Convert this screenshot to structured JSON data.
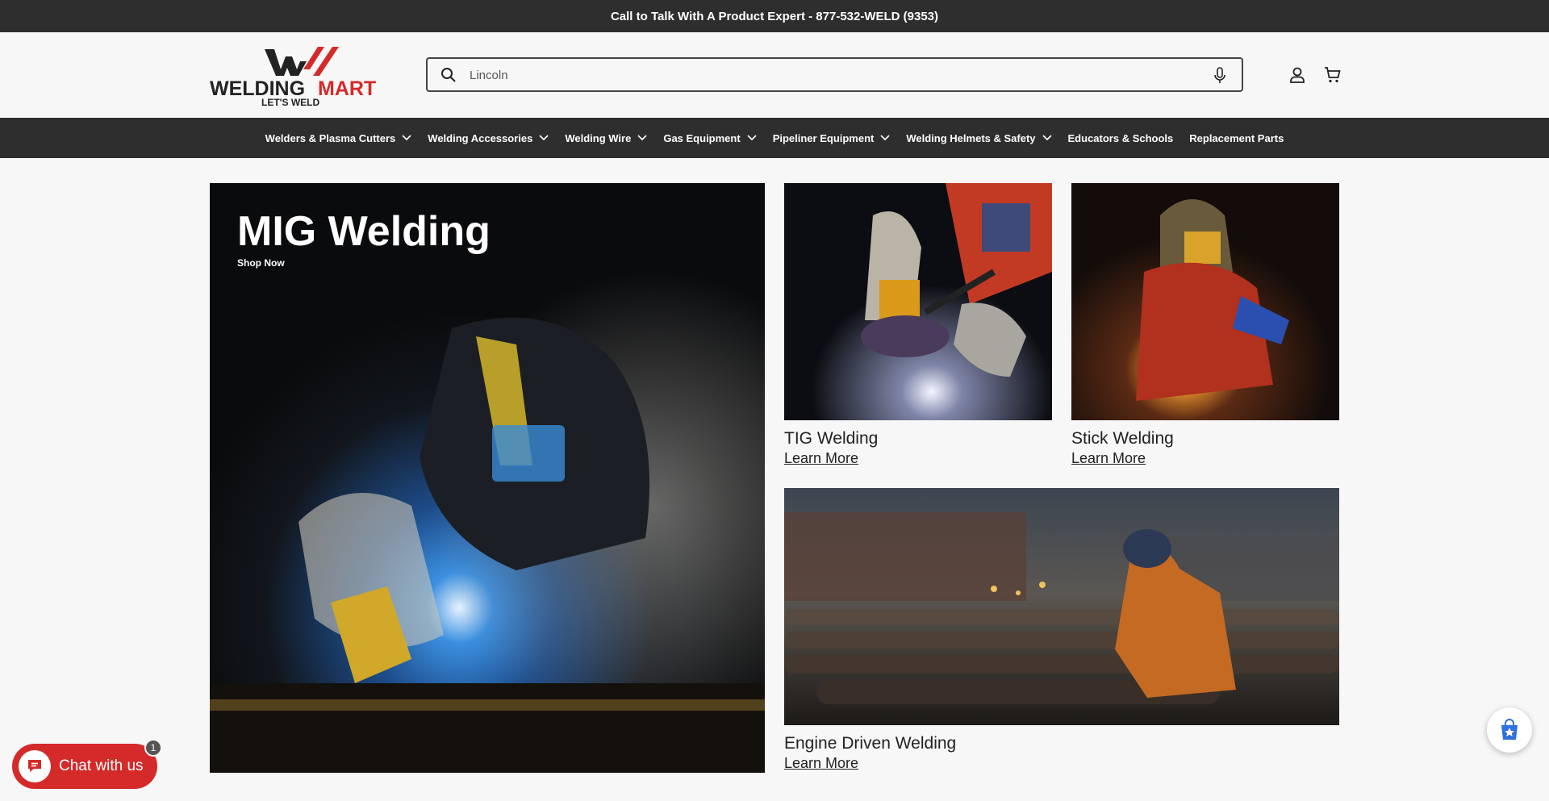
{
  "announcement": "Call to Talk With A Product Expert - 877-532-WELD (9353)",
  "logo": {
    "brand_main": "WELDING",
    "brand_accent": "MART",
    "tagline": "LET'S WELD",
    "accent_color": "#d42a2a"
  },
  "search": {
    "value": "",
    "placeholder": "Lincoln",
    "icon": "search-icon",
    "voice_icon": "microphone-icon"
  },
  "header_icons": [
    "account-icon",
    "cart-icon"
  ],
  "nav": {
    "items": [
      {
        "label": "Welders & Plasma Cutters",
        "has_dropdown": true
      },
      {
        "label": "Welding Accessories",
        "has_dropdown": true
      },
      {
        "label": "Welding Wire",
        "has_dropdown": true
      },
      {
        "label": "Gas Equipment",
        "has_dropdown": true
      },
      {
        "label": "Pipeliner Equipment",
        "has_dropdown": true
      },
      {
        "label": "Welding Helmets & Safety",
        "has_dropdown": true
      },
      {
        "label": "Educators & Schools",
        "has_dropdown": false
      },
      {
        "label": "Replacement Parts",
        "has_dropdown": false
      }
    ]
  },
  "hero": {
    "title": "MIG Welding",
    "cta": "Shop Now"
  },
  "cards": [
    {
      "title": "TIG Welding",
      "link": "Learn More"
    },
    {
      "title": "Stick Welding",
      "link": "Learn More"
    },
    {
      "title": "Engine Driven Welding",
      "link": "Learn More"
    }
  ],
  "chat": {
    "label": "Chat with us",
    "badge": "1"
  },
  "colors": {
    "dark_bar": "#2e2e2e",
    "chat_red": "#d42a2a",
    "background": "#f7f7f7"
  }
}
